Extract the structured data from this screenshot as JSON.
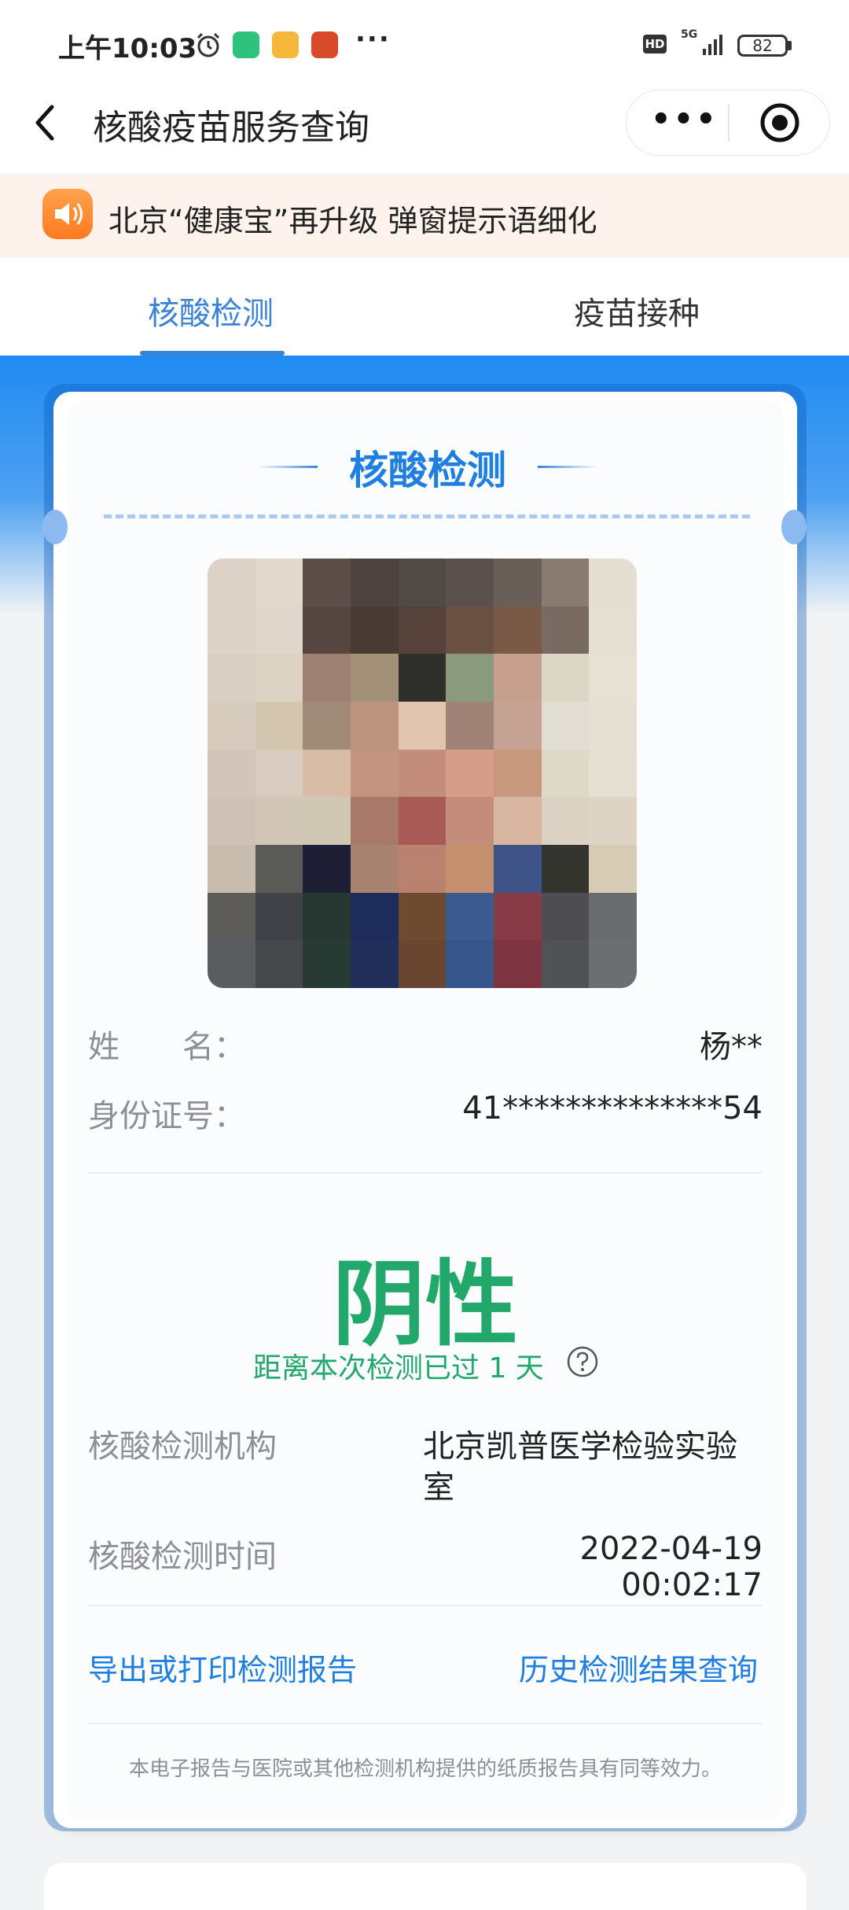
{
  "status_bar": {
    "time": "上午10:03",
    "more": "···",
    "hd": "HD",
    "network": "5G",
    "battery": "82"
  },
  "nav": {
    "title": "核酸疫苗服务查询",
    "capsule_more": "•••"
  },
  "notice": {
    "text": "北京“健康宝”再升级 弹窗提示语细化"
  },
  "tabs": [
    {
      "label": "核酸检测",
      "active": true
    },
    {
      "label": "疫苗接种",
      "active": false
    }
  ],
  "card": {
    "header": "核酸检测",
    "name_label": "姓　　名：",
    "name_value": "杨**",
    "id_label": "身份证号：",
    "id_value": "41**************54",
    "result": "阴性",
    "since_text": "距离本次检测已过 1 天",
    "institution_label": "核酸检测机构",
    "institution_value_line1": "北京凯普医学检验实验",
    "institution_value_line2": "室",
    "time_label": "核酸检测时间",
    "time_value": "2022-04-19 00:02:17",
    "export_link": "导出或打印检测报告",
    "history_link": "历史检测结果查询",
    "footnote": "本电子报告与医院或其他检测机构提供的纸质报告具有同等效力。"
  },
  "colors": {
    "accent_blue": "#3a82d6",
    "result_green": "#22a86a",
    "notice_bg": "#fdf2ec"
  },
  "photo_pixels": [
    "#dcd2c8",
    "#e2d8cc",
    "#5c4e48",
    "#4e423e",
    "#4f4a44",
    "#5b504c",
    "#6a5e58",
    "#8a7b70",
    "#e4ddd2",
    "#ddd3c8",
    "#e0d6cb",
    "#564640",
    "#4a3a34",
    "#56423a",
    "#6a5042",
    "#7a5a46",
    "#796a62",
    "#e6dfd4",
    "#d9cfc3",
    "#ddd3c5",
    "#9e8072",
    "#a39078",
    "#2e2e2a",
    "#8a9a7c",
    "#c6a08c",
    "#dcd7c4",
    "#e6e0d5",
    "#d6cbbc",
    "#d4c6ae",
    "#a08a78",
    "#bc9480",
    "#e0c6ae",
    "#a08276",
    "#c6a294",
    "#e2ddd2",
    "#e6e0d4",
    "#d2c6ba",
    "#d8ccc0",
    "#d8bca6",
    "#c49480",
    "#c48c7a",
    "#d69e88",
    "#c8987e",
    "#ded8c6",
    "#e4dfd2",
    "#cec2b6",
    "#d2c6b6",
    "#d0c8b4",
    "#a8786a",
    "#a85a56",
    "#c48c7a",
    "#d8b6a2",
    "#dcd2c4",
    "#ddd4c6",
    "#c8bcae",
    "#5a5a56",
    "#1e1e34",
    "#a88470",
    "#b8826e",
    "#c49070",
    "#3e5488",
    "#34342e",
    "#d6ccb4",
    "#5e5c58",
    "#404248",
    "#263630",
    "#1e2c5c",
    "#6e4a30",
    "#3a5a90",
    "#883a46",
    "#4e4e52",
    "#6a6c70",
    "#5a5c60",
    "#46484c",
    "#283a34",
    "#222e5a",
    "#6a4630",
    "#36568c",
    "#7e3440",
    "#505256",
    "#6c6e72"
  ]
}
